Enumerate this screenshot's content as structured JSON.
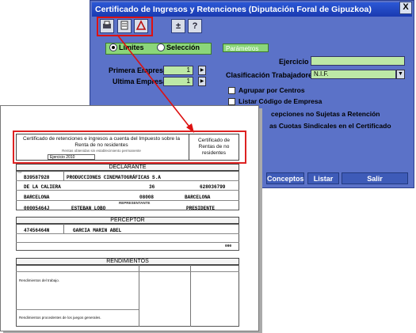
{
  "window": {
    "title": "Certificado de Ingresos y Retenciones (Diputación Foral de Gipuzkoa)",
    "close_glyph": "X",
    "toolbar": [
      {
        "icon": "printer-icon",
        "glyph": ""
      },
      {
        "icon": "preview-icon",
        "glyph": ""
      },
      {
        "icon": "pdf-icon",
        "glyph": ""
      },
      {
        "icon": "plus-minus-icon",
        "glyph": "±"
      },
      {
        "icon": "help-icon",
        "glyph": "?"
      }
    ],
    "mode": {
      "limites": "Límites",
      "seleccion": "Selección"
    },
    "primera_empresa": {
      "label": "Primera Empresa",
      "value": "1"
    },
    "ultima_empresa": {
      "label": "Ultima Empresa",
      "value": "1"
    },
    "parametros_tab": "Parámetros",
    "ejercicio_label": "Ejercicio",
    "clasificacion": {
      "label": "Clasificación Trabajadores",
      "value": "N.I.F."
    },
    "checks": {
      "centros": "Agrupar por Centros",
      "codigo": "Listar Código de Empresa",
      "sujetas": "cepciones no Sujetas a Retención",
      "cuotas": "as Cuotas Sindicales en el Certificado"
    },
    "buttons": {
      "conceptos": "Conceptos",
      "listar": "Listar",
      "salir": "Salir"
    }
  },
  "document": {
    "header_main": "Certificado de retenciones e ingresos a cuenta del Impuesto sobre la Renta de no residentes",
    "header_sub": "Rentas obtenidas sin establecimiento permanente",
    "header_right": "Certificado de Rentas de no residentes",
    "ejercicio": "Ejercicio 2010",
    "declarante_title": "DECLARANTE",
    "declarante": {
      "nif": "B39587928",
      "name": "PRODUCCIONES CINEMATOGRÁFICAS S.A",
      "street": "DE LA CALIERA",
      "number": "36",
      "phone": "628036799",
      "city": "BARCELONA",
      "cp": "08008",
      "province": "BARCELONA",
      "rep_label": "REPRESENTANTE",
      "rep_nif": "00005464J",
      "rep_name": "ESTEBAN LOBO",
      "rep_role": "PRESIDENTE"
    },
    "perceptor_title": "PERCEPTOR",
    "perceptor": {
      "nif": "47456464N",
      "name": "GARCIA MARIN ABEL",
      "code": "000"
    },
    "rendimientos_title": "RENDIMIENTOS",
    "rend_text_1": "Rendimientos del trabajo.",
    "rend_text_2": "Rendimientos procedentes de los juegos generales."
  }
}
